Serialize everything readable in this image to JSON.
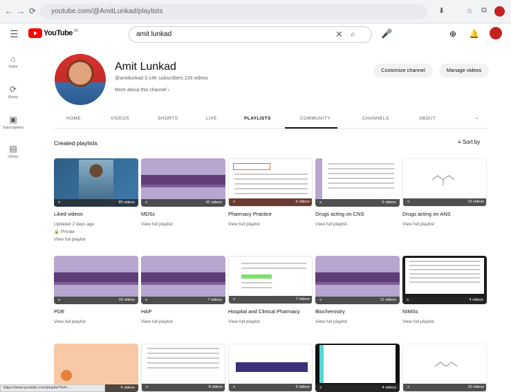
{
  "browser": {
    "url": "youtube.com/@AmitLunkad/playlists",
    "nav": [
      "←",
      "→",
      "⟳"
    ],
    "right_icons": [
      "⬇",
      "☆",
      "⧉"
    ]
  },
  "header": {
    "menu": "☰",
    "logo_text": "YouTube",
    "logo_cc": "IN",
    "search_query": "amit lunkad",
    "clear": "✕",
    "search_glyph": "⌕",
    "mic": "🎤",
    "create": "⊕",
    "bell": "🔔"
  },
  "sidebar": [
    {
      "icon": "⌂",
      "label": "Home"
    },
    {
      "icon": "⟳",
      "label": "Shorts"
    },
    {
      "icon": "▣",
      "label": "Subscriptions"
    },
    {
      "icon": "▤",
      "label": "Library"
    }
  ],
  "channel": {
    "name": "Amit Lunkad",
    "meta": "@amitlunkad  3.14K subscribers  233 videos",
    "more": "More about this channel  ›",
    "customize": "Customize channel",
    "manage": "Manage videos"
  },
  "tabs": [
    "HOME",
    "VIDEOS",
    "SHORTS",
    "LIVE",
    "PLAYLISTS",
    "COMMUNITY",
    "CHANNELS",
    "ABOUT",
    "⌕"
  ],
  "section": {
    "title": "Created playlists",
    "sort": "Sort by"
  },
  "row1": [
    {
      "title": "Liked videos",
      "count": "85 videos",
      "sub1": "Updated 2 days ago",
      "sub2": "Private",
      "sub3": "View full playlist"
    },
    {
      "title": "MDSc",
      "count": "42 videos",
      "sub1": "View full playlist"
    },
    {
      "title": "Pharmacy Practice",
      "count": "5 videos",
      "sub1": "View full playlist"
    },
    {
      "title": "Drugs acting on CNS",
      "count": "5 videos",
      "sub1": "View full playlist"
    },
    {
      "title": "Drugs acting on ANS",
      "count": "13 videos",
      "sub1": "View full playlist"
    }
  ],
  "row2": [
    {
      "title": "PDE",
      "count": "18 videos",
      "sub1": "View full playlist"
    },
    {
      "title": "HAP",
      "count": "7 videos",
      "sub1": "View full playlist"
    },
    {
      "title": "Hospital and Clinical Pharmacy",
      "count": "7 videos",
      "sub1": "View full playlist"
    },
    {
      "title": "Biochemistry",
      "count": "11 videos",
      "sub1": "View full playlist"
    },
    {
      "title": "NIMSs",
      "count": "4 videos",
      "sub1": "View full playlist"
    }
  ],
  "row3": [
    {
      "count": "5 videos"
    },
    {
      "count": "8 videos"
    },
    {
      "count": "9 videos"
    },
    {
      "count": "4 videos"
    },
    {
      "count": "10 videos"
    }
  ],
  "playlist_icon": "≡",
  "status_url": "https://www.youtube.com/playlist?list=...",
  "colors": {
    "brand": "#ff0000",
    "lavender": "#b7a6cf",
    "purple": "#5e3d78"
  }
}
